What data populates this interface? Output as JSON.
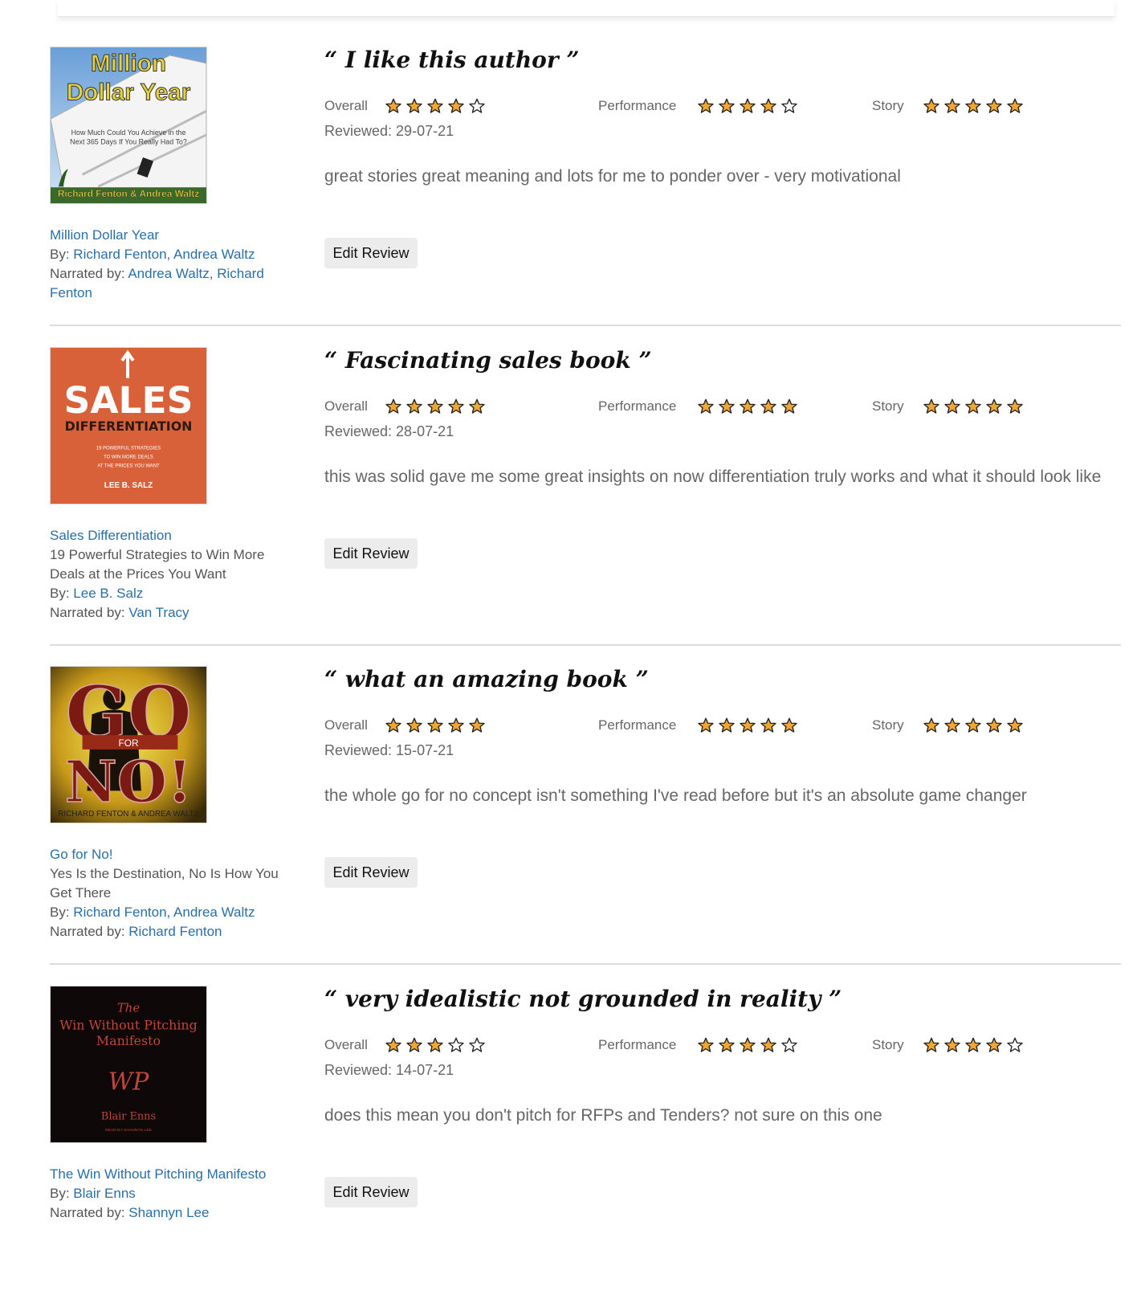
{
  "edit_label": "Edit Review",
  "labels": {
    "overall": "Overall",
    "performance": "Performance",
    "story": "Story",
    "reviewed_prefix": "Reviewed: ",
    "by_prefix": "By: ",
    "narrated_prefix": "Narrated by: "
  },
  "colors": {
    "link": "#2a6ea7",
    "star_fill": "#f2a530",
    "star_stroke": "#222222"
  },
  "reviews": [
    {
      "headline": "I like this author",
      "ratings": {
        "overall": 4,
        "performance": 4,
        "story": 5
      },
      "reviewed": "29-07-21",
      "text": "great stories great meaning and lots for me to ponder over - very motivational",
      "book": {
        "title": "Million Dollar Year",
        "subtitle": "",
        "authors": [
          "Richard Fenton",
          "Andrea Waltz"
        ],
        "narrators": [
          "Andrea Waltz",
          "Richard Fenton"
        ],
        "cover": {
          "line1": "Million",
          "line2": "Dollar Year",
          "tagline1": "How Much Could You Achieve in the",
          "tagline2": "Next 365 Days If You Really Had To?",
          "byline": "Richard Fenton & Andrea Waltz"
        }
      }
    },
    {
      "headline": "Fascinating sales book",
      "ratings": {
        "overall": 5,
        "performance": 5,
        "story": 5
      },
      "reviewed": "28-07-21",
      "text": "this was solid gave me some great insights on now differentiation truly works and what it should look like",
      "book": {
        "title": "Sales Differentiation",
        "subtitle": "19 Powerful Strategies to Win More Deals at the Prices You Want",
        "authors": [
          "Lee B. Salz"
        ],
        "narrators": [
          "Van Tracy"
        ],
        "cover": {
          "line1": "SALES",
          "line2": "DIFFERENTIATION",
          "tagline1": "19 POWERFUL STRATEGIES",
          "tagline2": "TO WIN MORE DEALS",
          "tagline3": "AT THE PRICES YOU WANT",
          "byline": "LEE B. SALZ"
        }
      }
    },
    {
      "headline": "what an amazing book",
      "ratings": {
        "overall": 5,
        "performance": 5,
        "story": 5
      },
      "reviewed": "15-07-21",
      "text": "the whole go for no concept isn't something I've read before but it's an absolute game changer",
      "book": {
        "title": "Go for No!",
        "subtitle": "Yes Is the Destination, No Is How You Get There",
        "authors": [
          "Richard Fenton",
          "Andrea Waltz"
        ],
        "narrators": [
          "Richard Fenton"
        ],
        "cover": {
          "line1": "GO",
          "mid": "FOR",
          "line2": "NO!",
          "byline": "RICHARD FENTON & ANDREA WALTZ"
        }
      }
    },
    {
      "headline": "very idealistic not grounded in reality",
      "ratings": {
        "overall": 3,
        "performance": 4,
        "story": 4
      },
      "reviewed": "14-07-21",
      "text": "does this mean you don't pitch for RFPs and Tenders? not sure on this one",
      "book": {
        "title": "The Win Without Pitching Manifesto",
        "subtitle": "",
        "authors": [
          "Blair Enns"
        ],
        "narrators": [
          "Shannyn Lee"
        ],
        "cover": {
          "line0": "The",
          "line1": "Win Without Pitching",
          "line2": "Manifesto",
          "monogram": "WP",
          "byline": "Blair Enns",
          "tagline1": "READ BY SHANNYN LEE"
        }
      }
    }
  ]
}
